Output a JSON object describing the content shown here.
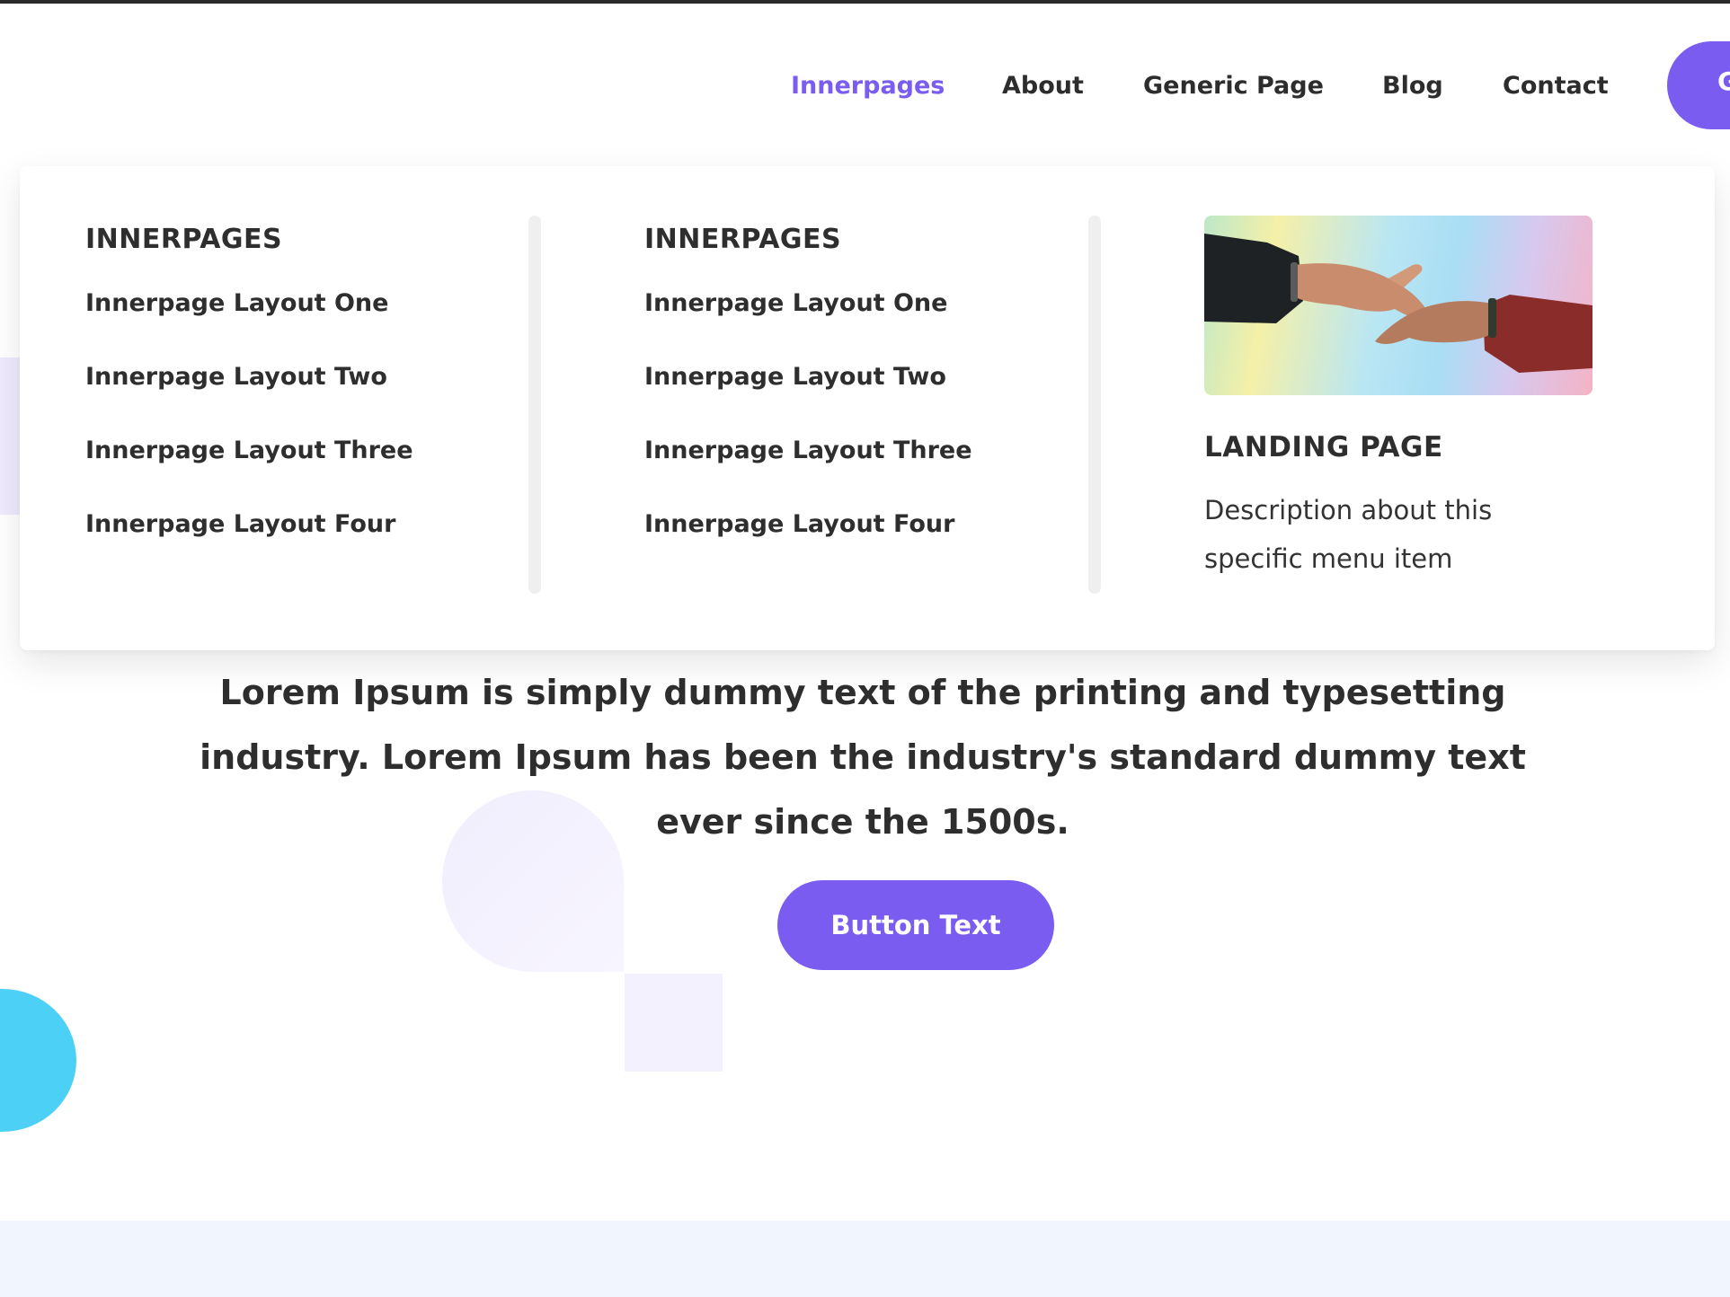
{
  "nav": {
    "items": [
      {
        "label": "Innerpages",
        "active": true
      },
      {
        "label": "About"
      },
      {
        "label": "Generic Page"
      },
      {
        "label": "Blog"
      },
      {
        "label": "Contact"
      }
    ],
    "cta_label": "G"
  },
  "mega_menu": {
    "columns": [
      {
        "title": "INNERPAGES",
        "items": [
          "Innerpage Layout One",
          "Innerpage Layout Two",
          "Innerpage Layout Three",
          "Innerpage Layout Four"
        ]
      },
      {
        "title": "INNERPAGES",
        "items": [
          "Innerpage Layout One",
          "Innerpage Layout Two",
          "Innerpage Layout Three",
          "Innerpage Layout Four"
        ]
      }
    ],
    "promo": {
      "title": "LANDING PAGE",
      "description": "Description about this specific menu item"
    }
  },
  "hero": {
    "text": "Lorem Ipsum is simply dummy text of the printing and typesetting industry. Lorem Ipsum has been the industry's standard dummy text ever since the 1500s.",
    "button_label": "Button Text"
  },
  "colors": {
    "accent": "#7b5cf0",
    "cyan": "#4dd0f5",
    "text": "#2e2e2e"
  }
}
